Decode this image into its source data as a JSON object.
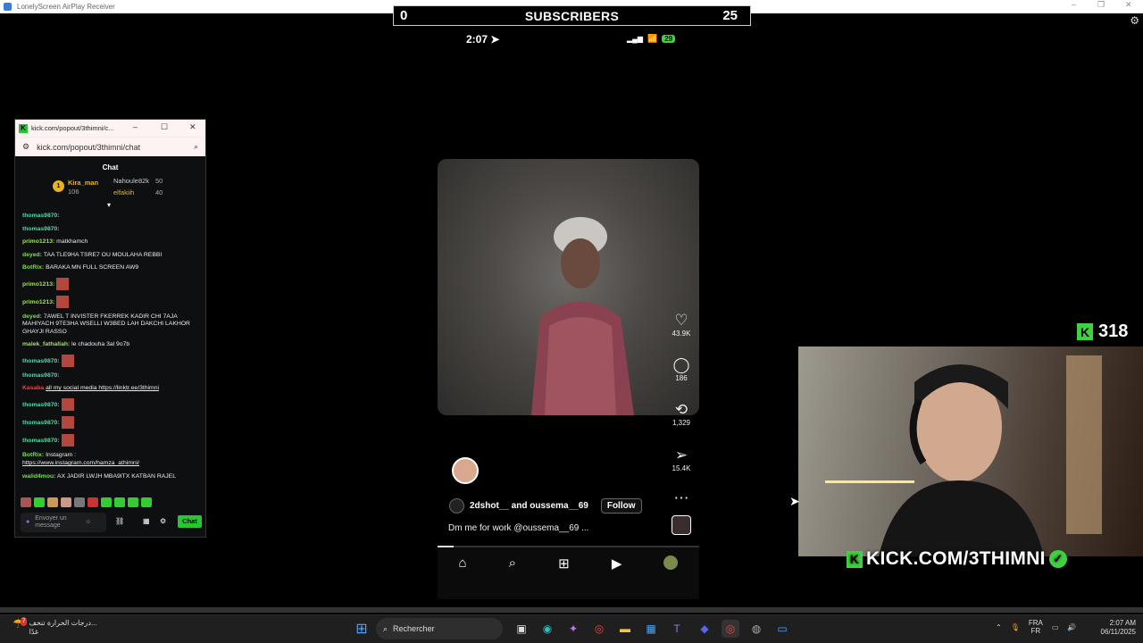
{
  "window": {
    "title": "LonelyScreen AirPlay Receiver"
  },
  "overlay": {
    "subscribers_label": "SUBSCRIBERS",
    "subscribers_current": "0",
    "subscribers_goal": "25",
    "kick_viewers": "318",
    "kick_url": "KICK.COM/3THIMNI"
  },
  "phone": {
    "time": "2:07",
    "battery": "29",
    "likes": "43.9K",
    "comments": "186",
    "reposts": "1,329",
    "shares": "15.4K",
    "author": "2dshot__ and oussema__69",
    "follow_label": "Follow",
    "caption": "Dm me for work @oussema__69 ..."
  },
  "chat": {
    "title": "kick.com/popout/3thimni/c...",
    "url": "kick.com/popout/3thimni/chat",
    "header": "Chat",
    "leaders": [
      {
        "rank": "1",
        "name": "Kira_man",
        "value": "106"
      },
      {
        "name": "Nahoule82k",
        "value": "50"
      },
      {
        "name": "elfakiih",
        "value": "40"
      }
    ],
    "messages": [
      {
        "user": "thomas9870:",
        "text": ""
      },
      {
        "user": "thomas9870:",
        "text": ""
      },
      {
        "user": "primo1213:",
        "text": "matkhamch"
      },
      {
        "user": "deyed:",
        "text": "TAA TLE9HA TSRE7 OU MOULAHA REBBI"
      },
      {
        "user": "BotRix:",
        "text": "BARAKA MN FULL SCREEN AW9"
      },
      {
        "user": "primo1213:",
        "text": ""
      },
      {
        "user": "primo1213:",
        "text": ""
      },
      {
        "user": "deyed:",
        "text": "7AWEL T INVISTER FKERREK KADIR CHI 7AJA MAHIYACH 9TE3HA WSELLI W3BED LAH DAKCHI LAKHOR GHAYJI RASSO"
      },
      {
        "user": "malek_fathallah:",
        "text": "le chadouha 3al 9o7b"
      },
      {
        "user": "thomas9870:",
        "text": ""
      },
      {
        "user": "thomas9870:",
        "text": ""
      },
      {
        "user": "Kasaba",
        "text": "all my social media https://linktr.ee/3thimni"
      },
      {
        "user": "thomas9870:",
        "text": ""
      },
      {
        "user": "thomas9870:",
        "text": ""
      },
      {
        "user": "thomas9870:",
        "text": ""
      },
      {
        "user": "BotRix:",
        "text": "Instagram :"
      },
      {
        "user": "",
        "text": "https://www.instagram.com/hamza_athimni/"
      },
      {
        "user": "walid4mou:",
        "text": "AX JADIR LWJH MBA9ITX KATBAN RAJEL"
      }
    ],
    "input_placeholder": "Envoyer un message",
    "send_label": "Chat"
  },
  "taskbar": {
    "weather_line1": "درجات الحرارة تنخف...",
    "weather_line2": "غدًا",
    "weather_badge": "7",
    "search_placeholder": "Rechercher",
    "lang_line1": "FRA",
    "lang_line2": "FR",
    "time": "2:07 AM",
    "date": "06/11/2025"
  },
  "colors": {
    "kick_green": "#27c635",
    "chat_bg": "#0e0f10",
    "taskbar_bg": "#1f1f1f"
  }
}
